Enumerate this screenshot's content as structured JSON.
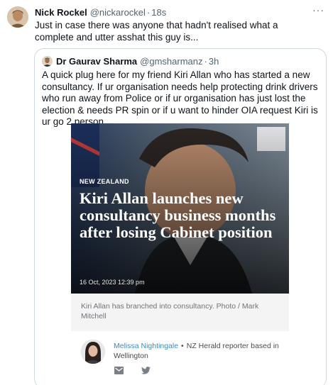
{
  "tweet": {
    "display_name": "Nick Rockel",
    "handle": "@nickarockel",
    "separator": "·",
    "time": "18s",
    "more_label": "···",
    "text": "Just in case there was anyone that hadn't realised what a complete and utter asshat this guy is..."
  },
  "quote": {
    "display_name": "Dr Gaurav Sharma",
    "handle": "@gmsharmanz",
    "separator": "·",
    "time": "3h",
    "text": "A quick plug here for my friend Kiri Allan who has started a new consultancy. If ur organisation needs help protecting drink drivers who run away from Police or if ur organisation has just lost the election & needs PR spin or if u want to hinder OIA request Kiri is ur go 2 person"
  },
  "article": {
    "kicker": "NEW ZEALAND",
    "headline": "Kiri Allan launches new consultancy business months after losing Cabinet position",
    "date": "16 Oct, 2023 12:39 pm",
    "caption": "Kiri Allan has branched into consultancy. Photo / Mark Mitchell",
    "author_name": "Melissa Nightingale",
    "author_bullet": "•",
    "author_role": "NZ Herald reporter based in Wellington",
    "share_icons": [
      "mail-icon",
      "twitter-icon"
    ]
  },
  "colors": {
    "link_blue": "#3a8cbf",
    "muted_text": "#536471",
    "card_border": "#cfd9de"
  }
}
